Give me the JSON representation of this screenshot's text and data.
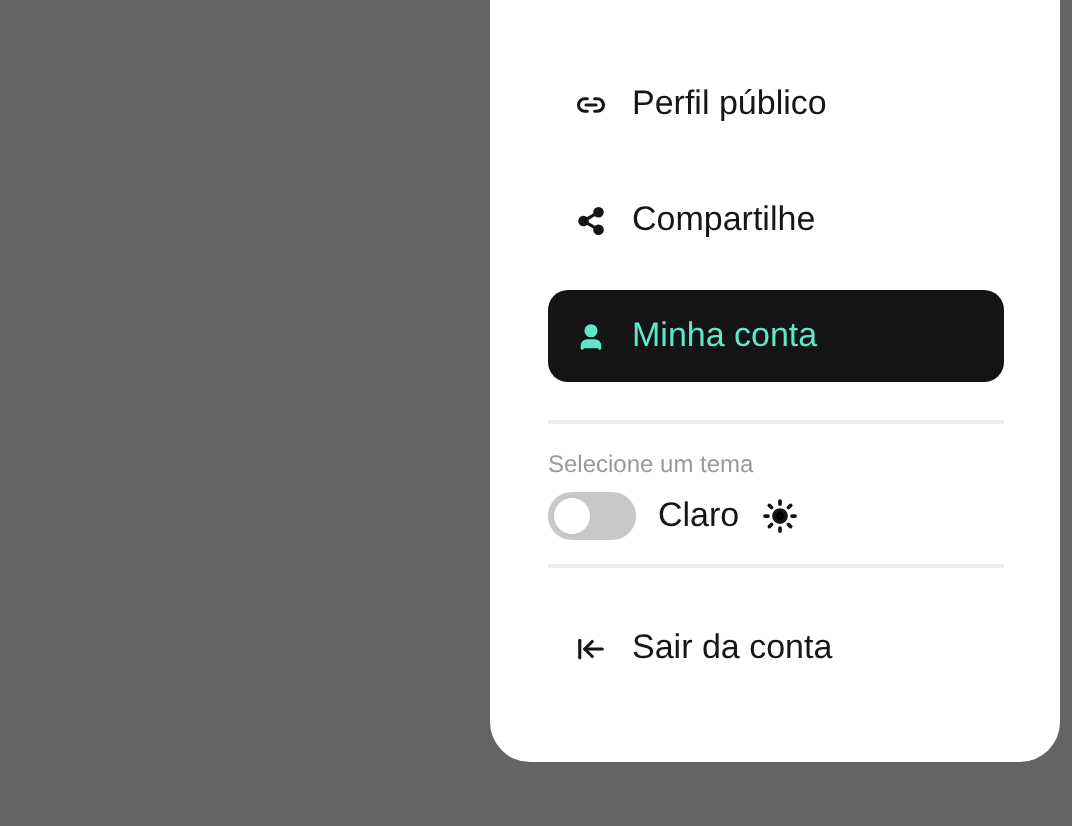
{
  "menu": [
    {
      "label": "Perfil público",
      "selected": false
    },
    {
      "label": "Compartilhe",
      "selected": false
    },
    {
      "label": "Minha conta",
      "selected": true
    }
  ],
  "theme": {
    "label": "Selecione um tema",
    "dark_mode": false,
    "name": "Claro"
  },
  "logout": {
    "label": "Sair da conta"
  }
}
